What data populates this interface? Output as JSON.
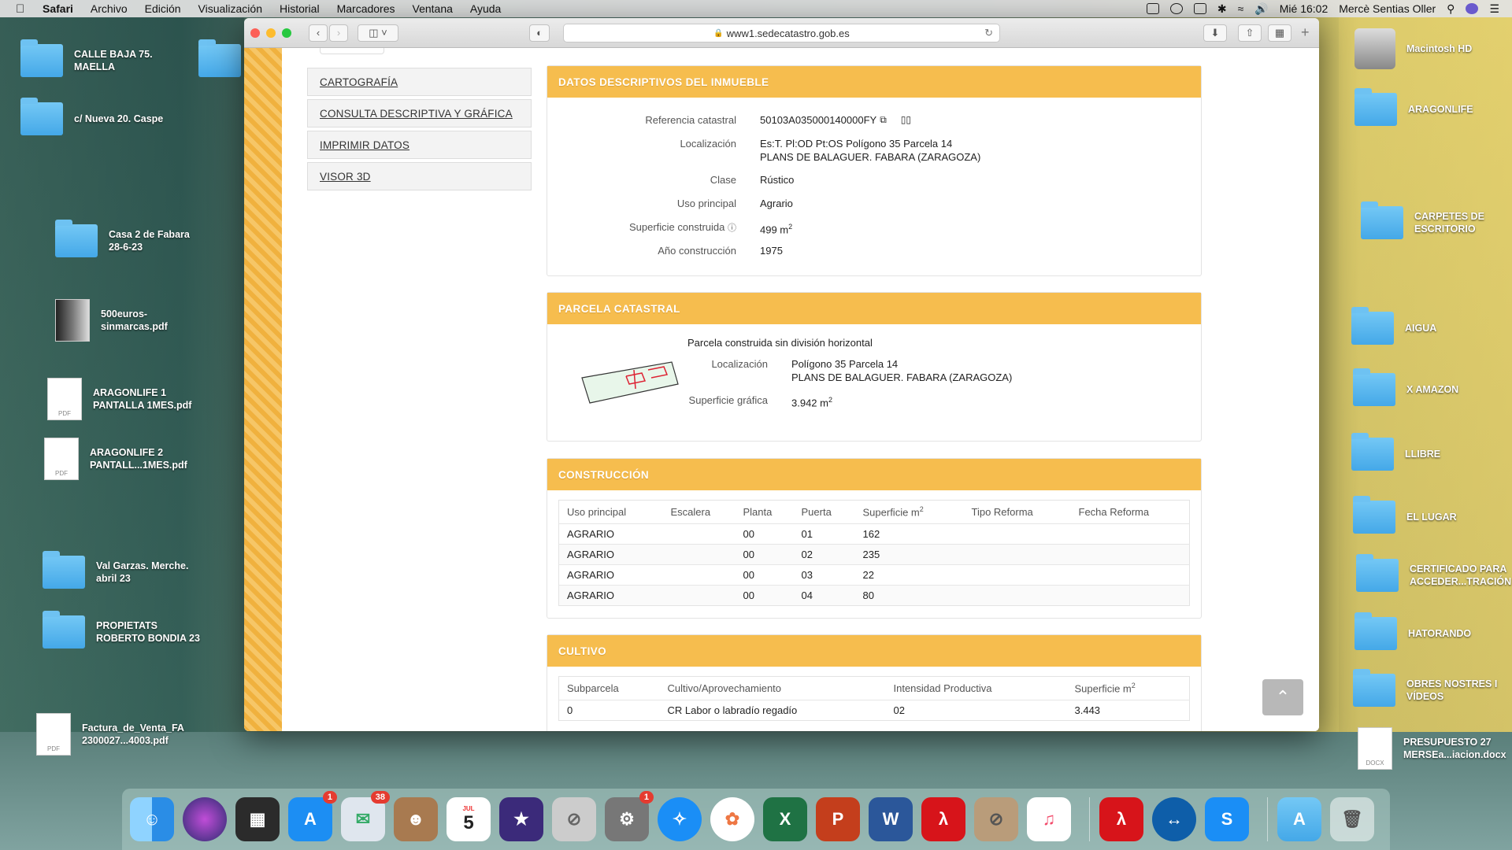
{
  "menubar": {
    "app": "Safari",
    "items": [
      "Archivo",
      "Edición",
      "Visualización",
      "Historial",
      "Marcadores",
      "Ventana",
      "Ayuda"
    ],
    "clock": "Mié 16:02",
    "user": "Mercè Sentias Oller"
  },
  "desktop_left": [
    {
      "label": "CALLE BAJA 75.\nMAELLA",
      "type": "folder"
    },
    {
      "label": "c/ Nueva 20. Caspe",
      "type": "folder"
    },
    {
      "label": "Casa 2 de Fabara\n28-6-23",
      "type": "folder"
    },
    {
      "label": "500euros-\nsinmarcas.pdf",
      "type": "doc"
    },
    {
      "label": "ARAGONLIFE 1\nPANTALLA 1MES.pdf",
      "type": "pdf"
    },
    {
      "label": "ARAGONLIFE 2\nPANTALL...1MES.pdf",
      "type": "pdf"
    },
    {
      "label": "Val Garzas. Merche.\nabril 23",
      "type": "folder"
    },
    {
      "label": "PROPIETATS\nROBERTO BONDIA 23",
      "type": "folder"
    },
    {
      "label": "Factura_de_Venta_FA\n2300027...4003.pdf",
      "type": "pdf"
    }
  ],
  "desktop_right": [
    {
      "label": "Macintosh HD",
      "type": "disk"
    },
    {
      "label": "ARAGONLIFE",
      "type": "folder"
    },
    {
      "label": "CARPETES DE\nESCRITORIO",
      "type": "folder"
    },
    {
      "label": "AIGUA",
      "type": "folder"
    },
    {
      "label": "X AMAZON",
      "type": "folder"
    },
    {
      "label": "LLIBRE",
      "type": "folder"
    },
    {
      "label": "EL LUGAR",
      "type": "folder"
    },
    {
      "label": "CERTIFICADO PARA\nACCEDER...TRACIÓN",
      "type": "folder"
    },
    {
      "label": "HATORANDO",
      "type": "folder"
    },
    {
      "label": "OBRES NOSTRES I\nVÍDEOS",
      "type": "folder"
    },
    {
      "label": "PRESUPUESTO 27\nMERSEa...iacion.docx",
      "type": "docx"
    }
  ],
  "browser": {
    "url": "www1.sedecatastro.gob.es"
  },
  "sidebar": {
    "items": [
      "CARTOGRAFÍA",
      "CONSULTA DESCRIPTIVA Y GRÁFICA",
      "IMPRIMIR DATOS",
      "VISOR 3D"
    ]
  },
  "datos": {
    "title": "DATOS DESCRIPTIVOS DEL INMUEBLE",
    "ref_label": "Referencia catastral",
    "ref_value": "50103A035000140000FY",
    "loc_label": "Localización",
    "loc_value_1": "Es:T. Pl:OD Pt:OS Polígono 35 Parcela 14",
    "loc_value_2": "PLANS DE BALAGUER. FABARA (ZARAGOZA)",
    "clase_label": "Clase",
    "clase_value": "Rústico",
    "uso_label": "Uso principal",
    "uso_value": "Agrario",
    "sup_label": "Superficie construida",
    "sup_value": "499 m",
    "anio_label": "Año construcción",
    "anio_value": "1975"
  },
  "parcela": {
    "title": "PARCELA CATASTRAL",
    "subtitle": "Parcela construida sin división horizontal",
    "loc_label": "Localización",
    "loc_value_1": "Polígono 35 Parcela 14",
    "loc_value_2": "PLANS DE BALAGUER. FABARA (ZARAGOZA)",
    "sup_label": "Superficie gráfica",
    "sup_value": "3.942 m"
  },
  "construccion": {
    "title": "CONSTRUCCIÓN",
    "headers": [
      "Uso principal",
      "Escalera",
      "Planta",
      "Puerta",
      "Superficie m",
      "Tipo Reforma",
      "Fecha Reforma"
    ],
    "rows": [
      [
        "AGRARIO",
        "",
        "00",
        "01",
        "162",
        "",
        ""
      ],
      [
        "AGRARIO",
        "",
        "00",
        "02",
        "235",
        "",
        ""
      ],
      [
        "AGRARIO",
        "",
        "00",
        "03",
        "22",
        "",
        ""
      ],
      [
        "AGRARIO",
        "",
        "00",
        "04",
        "80",
        "",
        ""
      ]
    ]
  },
  "cultivo": {
    "title": "CULTIVO",
    "headers": [
      "Subparcela",
      "Cultivo/Aprovechamiento",
      "Intensidad Productiva",
      "Superficie m"
    ],
    "rows": [
      [
        "0",
        "CR Labor o labradío regadío",
        "02",
        "3.443"
      ]
    ]
  },
  "dock": {
    "badges": {
      "appstore": "1",
      "mail": "38",
      "prefs": "1"
    },
    "calendar_month": "JUL",
    "calendar_day": "5"
  }
}
